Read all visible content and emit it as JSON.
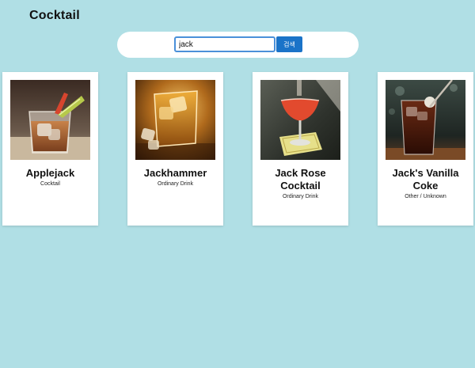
{
  "header": {
    "title": "Cocktail"
  },
  "search": {
    "value": "jack",
    "button_label": "검색"
  },
  "drinks": [
    {
      "name": "Applejack",
      "category": "Cocktail",
      "image": "applejack-photo"
    },
    {
      "name": "Jackhammer",
      "category": "Ordinary Drink",
      "image": "jackhammer-photo"
    },
    {
      "name": "Jack Rose Cocktail",
      "category": "Ordinary Drink",
      "image": "jack-rose-photo"
    },
    {
      "name": "Jack's Vanilla Coke",
      "category": "Other / Unknown",
      "image": "vanilla-coke-photo"
    }
  ]
}
